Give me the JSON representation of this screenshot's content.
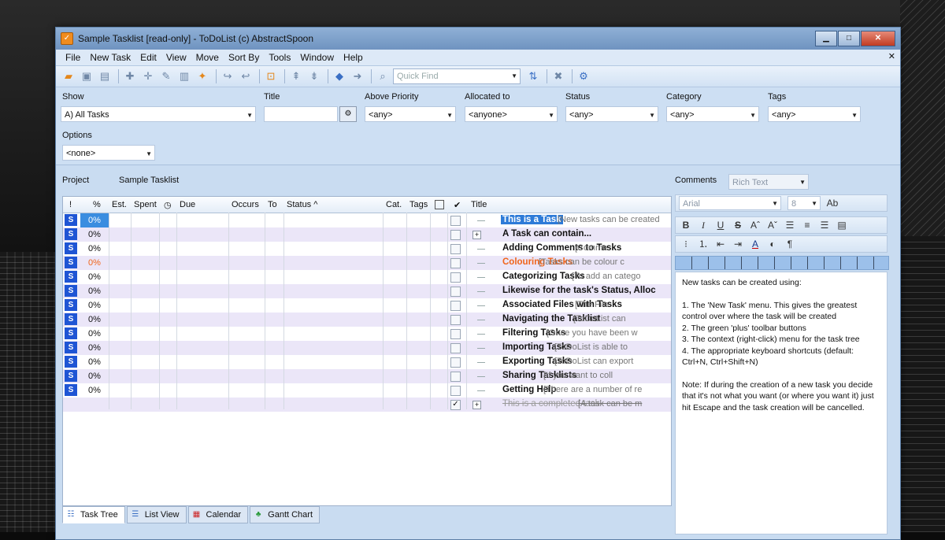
{
  "window": {
    "title": "Sample Tasklist [read-only] - ToDoList (c) AbstractSpoon",
    "app_icon": "checkmark-icon",
    "buttons": [
      "minimize",
      "maximize",
      "close"
    ]
  },
  "menu": [
    "File",
    "New Task",
    "Edit",
    "View",
    "Move",
    "Sort By",
    "Tools",
    "Window",
    "Help"
  ],
  "toolbar": {
    "quickfind_placeholder": "Quick Find"
  },
  "filters": {
    "show_label": "Show",
    "show_value": "A)   All Tasks",
    "title_label": "Title",
    "title_value": "",
    "priority_label": "Above Priority",
    "priority_value": "<any>",
    "allocated_label": "Allocated to",
    "allocated_value": "<anyone>",
    "status_label": "Status",
    "status_value": "<any>",
    "category_label": "Category",
    "category_value": "<any>",
    "tags_label": "Tags",
    "tags_value": "<any>",
    "options_label": "Options",
    "options_value": "<none>"
  },
  "project": {
    "label": "Project",
    "value": "Sample Tasklist"
  },
  "grid": {
    "columns": [
      "!",
      "%",
      "Est.",
      "Spent",
      "◷",
      "Due",
      "Occurs",
      "To",
      "Status ^",
      "Cat.",
      "Tags",
      "",
      "✔",
      "Title"
    ],
    "rows": [
      {
        "badge": "S",
        "percent": "0%",
        "title": "This is a Task",
        "comment": "[New tasks can be created",
        "style": "selected",
        "checked": "",
        "plus": false
      },
      {
        "badge": "S",
        "percent": "0%",
        "title": "A Task can contain...",
        "comment": "",
        "style": "normal",
        "checked": "",
        "plus": true
      },
      {
        "badge": "S",
        "percent": "0%",
        "title": "Adding Comments to Tasks",
        "comment": "[Comme",
        "style": "normal",
        "checked": "",
        "plus": false
      },
      {
        "badge": "S",
        "percent": "0%",
        "title": "Colouring Tasks",
        "comment": "[Tasks can be colour c",
        "style": "orange",
        "checked": "",
        "plus": false
      },
      {
        "badge": "S",
        "percent": "0%",
        "title": "Categorizing Tasks",
        "comment": "[To add an catego",
        "style": "normal",
        "checked": "",
        "plus": false
      },
      {
        "badge": "S",
        "percent": "0%",
        "title": "Likewise for the task's Status, Alloc",
        "comment": "",
        "style": "normal",
        "checked": "",
        "plus": false
      },
      {
        "badge": "S",
        "percent": "0%",
        "title": "Associated Files with Tasks",
        "comment": "[The File",
        "style": "normal",
        "checked": "",
        "plus": false
      },
      {
        "badge": "S",
        "percent": "0%",
        "title": "Navigating the Tasklist",
        "comment": "[ToDoList can",
        "style": "normal",
        "checked": "",
        "plus": false
      },
      {
        "badge": "S",
        "percent": "0%",
        "title": "Filtering Tasks",
        "comment": "[Once you have been w",
        "style": "normal",
        "checked": "",
        "plus": false
      },
      {
        "badge": "S",
        "percent": "0%",
        "title": "Importing Tasks",
        "comment": "[ToDoList is able to",
        "style": "normal",
        "checked": "",
        "plus": false
      },
      {
        "badge": "S",
        "percent": "0%",
        "title": "Exporting Tasks",
        "comment": "[ToDoList can export",
        "style": "normal",
        "checked": "",
        "plus": false
      },
      {
        "badge": "S",
        "percent": "0%",
        "title": "Sharing Tasklists",
        "comment": "[If you want to coll",
        "style": "normal",
        "checked": "",
        "plus": false
      },
      {
        "badge": "S",
        "percent": "0%",
        "title": "Getting Help",
        "comment": "[There are a number of re",
        "style": "normal",
        "checked": "",
        "plus": false
      },
      {
        "badge": "",
        "percent": "",
        "title": "This is a completed task",
        "comment": "[A task can be m",
        "style": "done",
        "checked": "✓",
        "plus": true
      }
    ]
  },
  "tabs": [
    {
      "label": "Task Tree",
      "icon": "tree-icon",
      "active": true
    },
    {
      "label": "List View",
      "icon": "list-icon",
      "active": false
    },
    {
      "label": "Calendar",
      "icon": "calendar-icon",
      "active": false
    },
    {
      "label": "Gantt Chart",
      "icon": "gantt-icon",
      "active": false
    }
  ],
  "comments": {
    "label": "Comments",
    "format_value": "Rich Text",
    "font_value": "Arial",
    "size_value": "8",
    "text": [
      "New tasks can be created using:",
      "",
      "1. The 'New Task' menu. This gives the greatest control over where the task will be created",
      "2. The green 'plus' toolbar buttons",
      "3. The context (right-click) menu for the task tree",
      "4. The appropriate keyboard shortcuts (default: Ctrl+N, Ctrl+Shift+N)",
      "",
      "Note: If during the creation of a new task you decide that it's not what you want (or where you want it) just hit Escape and the task creation will be cancelled."
    ]
  },
  "colors": {
    "badge": "#1f55d4",
    "selection": "#2e7bd8",
    "orange_task": "#f0651b",
    "alt_row": "#ebe6f8"
  }
}
